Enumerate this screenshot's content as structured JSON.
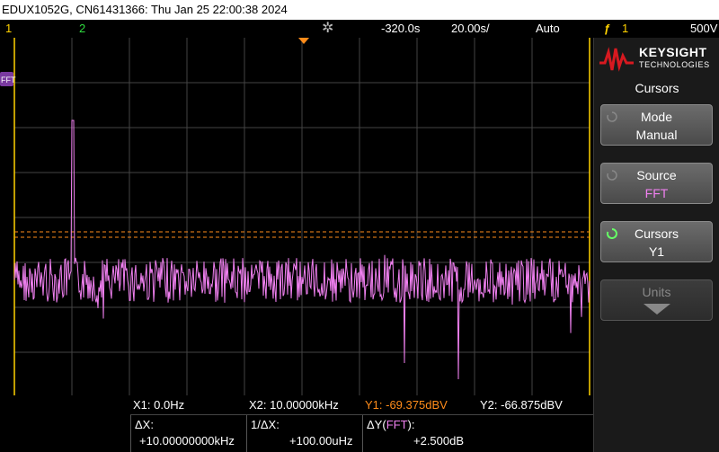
{
  "title": "EDUX1052G, CN61431366: Thu Jan 25 22:00:38 2024",
  "status": {
    "ch1": "1",
    "ch2": "2",
    "time_delay": "-320.0s",
    "time_scale": "20.00s/",
    "trigger_mode": "Auto",
    "trigger_symbol": "ƒ",
    "trigger_channel": "1",
    "trigger_level": "500V"
  },
  "brand": {
    "name": "KEYSIGHT",
    "sub": "TECHNOLOGIES",
    "color": "#d71920"
  },
  "menu": {
    "title": "Cursors",
    "softkeys": [
      {
        "label": "Mode",
        "value": "Manual"
      },
      {
        "label": "Source",
        "value": "FFT"
      },
      {
        "label": "Cursors",
        "value": "Y1"
      },
      {
        "label": "Units",
        "value": ""
      }
    ]
  },
  "fft_marker": "FFT",
  "readout": {
    "x1": "X1:  0.0Hz",
    "x2": "X2:  10.00000kHz",
    "y1": "Y1: -69.375dBV",
    "y2": "Y2: -66.875dBV",
    "dx_label": "ΔX:",
    "dx_value": "+10.00000000kHz",
    "inv_dx_label": "1/ΔX:",
    "inv_dx_value": "+100.00uHz",
    "dy_label_prefix": "ΔY(",
    "dy_label_source": "FFT",
    "dy_label_suffix": "):",
    "dy_value": "+2.500dB"
  },
  "colors": {
    "ch1": "#ffd200",
    "ch2": "#2fdc3f",
    "fft": "#f080f0",
    "cursor_y1": "#ff8c1a",
    "grid": "#444444",
    "trigger_marker": "#ff8c1a"
  },
  "chart_data": {
    "type": "line",
    "series": [
      {
        "values": [
          -78,
          -77,
          -79,
          -81,
          -76,
          -78,
          -80,
          -77,
          -79,
          -82,
          -78,
          -52,
          -77,
          -80,
          -78
        ]
      }
    ],
    "cursors": {
      "y1": -69.375,
      "y2": -66.875
    }
  }
}
